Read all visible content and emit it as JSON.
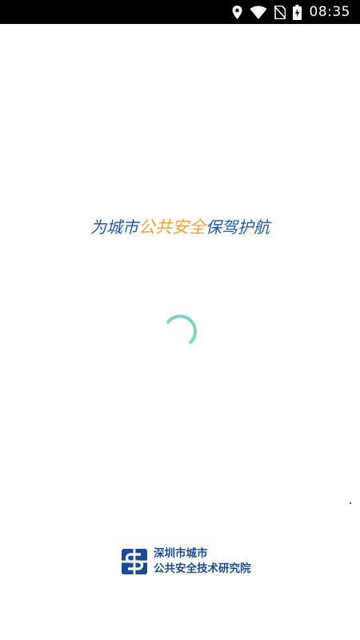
{
  "status_bar": {
    "time": "08:35",
    "icons": [
      "location-icon",
      "wifi-icon",
      "no-sim-icon",
      "battery-charging-icon"
    ]
  },
  "splash": {
    "slogan_part1": "为城市",
    "slogan_part2": "公共安全",
    "slogan_part3": "保驾护航",
    "loading": true
  },
  "organization": {
    "name_line1": "深圳市城市",
    "name_line2": "公共安全技术研究院"
  },
  "colors": {
    "brand_blue": "#1f56a8",
    "slogan_orange": "#f0a33a",
    "spinner_teal": "#7fd3c6",
    "status_bar_bg": "#000000"
  }
}
